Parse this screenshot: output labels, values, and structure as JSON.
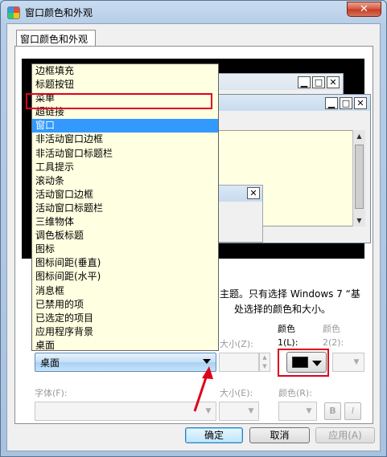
{
  "window": {
    "title": "窗口颜色和外观",
    "close_label": "✕"
  },
  "tab": {
    "label": "窗口颜色和外观"
  },
  "preview": {
    "win_buttons": [
      "▁",
      "□",
      "✕"
    ]
  },
  "info": {
    "line1": "主题。只有选择 Windows 7 “基",
    "line2": "处选择的颜色和大小。"
  },
  "item_row": {
    "size_label": "大小(Z):",
    "color1_label_a": "颜色",
    "color1_label_b": "1(L):",
    "color2_label_a": "颜色",
    "color2_label_b": "2(2):",
    "selected_item": "桌面",
    "color1_value": "#000000"
  },
  "font_row": {
    "font_label": "字体(F):",
    "size_label": "大小(E):",
    "color_label": "颜色(R):",
    "bold_label": "B",
    "italic_label": "I"
  },
  "dropdown": {
    "items": [
      "边框填充",
      "标题按钮",
      "菜单",
      "超链接",
      "窗口",
      "非活动窗口边框",
      "非活动窗口标题栏",
      "工具提示",
      "滚动条",
      "活动窗口边框",
      "活动窗口标题栏",
      "三维物体",
      "调色板标题",
      "图标",
      "图标间距(垂直)",
      "图标间距(水平)",
      "消息框",
      "已禁用的项",
      "已选定的项目",
      "应用程序背景",
      "桌面"
    ],
    "highlighted_index": 4
  },
  "buttons": {
    "ok": "确定",
    "cancel": "取消",
    "apply": "应用(A)"
  },
  "colors": {
    "highlight_red": "#e0001a",
    "selection_blue": "#3399ff",
    "list_background": "#ffffe1"
  }
}
